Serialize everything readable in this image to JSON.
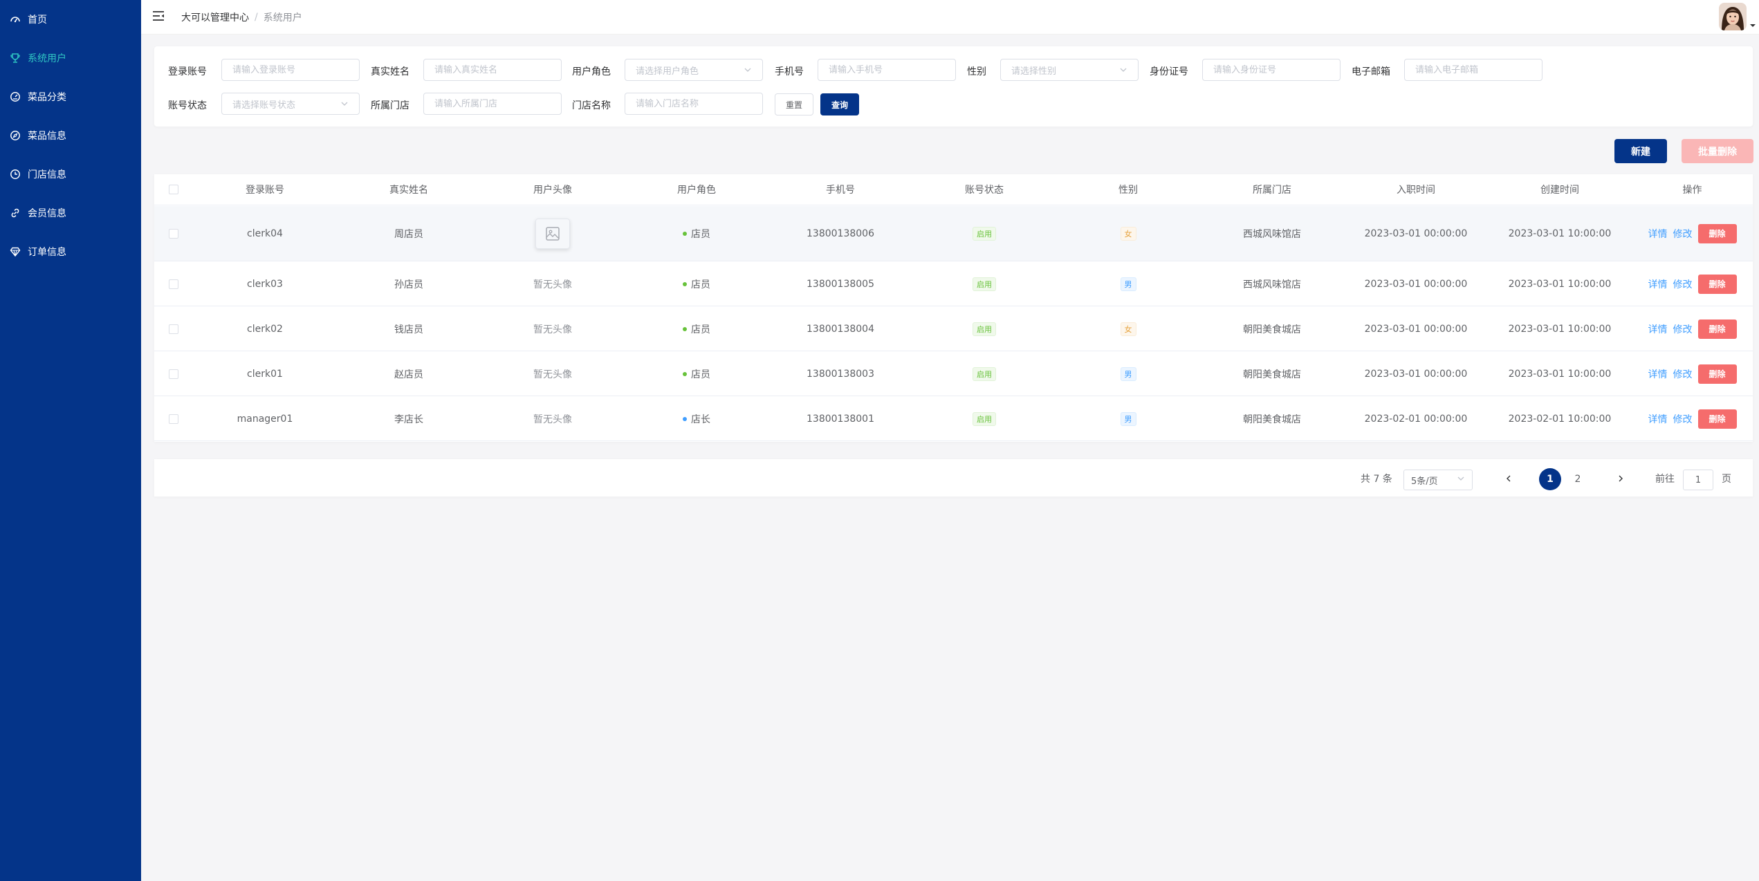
{
  "sidebar": {
    "items": [
      {
        "label": "首页",
        "icon": "dashboard-icon"
      },
      {
        "label": "系统用户",
        "icon": "trophy-icon",
        "active": true
      },
      {
        "label": "菜品分类",
        "icon": "gauge-icon"
      },
      {
        "label": "菜品信息",
        "icon": "compass-icon"
      },
      {
        "label": "门店信息",
        "icon": "clock-icon"
      },
      {
        "label": "会员信息",
        "icon": "link-icon"
      },
      {
        "label": "订单信息",
        "icon": "diamond-icon"
      }
    ],
    "bg_color": "#043489",
    "active_color": "#2fc7c3"
  },
  "header": {
    "breadcrumb_home": "大可以管理中心",
    "breadcrumb_separator": "/",
    "breadcrumb_current": "系统用户"
  },
  "filters": {
    "login_account": {
      "label": "登录账号",
      "placeholder": "请输入登录账号"
    },
    "real_name": {
      "label": "真实姓名",
      "placeholder": "请输入真实姓名"
    },
    "user_role": {
      "label": "用户角色",
      "placeholder": "请选择用户角色"
    },
    "phone": {
      "label": "手机号",
      "placeholder": "请输入手机号"
    },
    "gender": {
      "label": "性别",
      "placeholder": "请选择性别"
    },
    "id_card": {
      "label": "身份证号",
      "placeholder": "请输入身份证号"
    },
    "email": {
      "label": "电子邮箱",
      "placeholder": "请输入电子邮箱"
    },
    "account_status": {
      "label": "账号状态",
      "placeholder": "请选择账号状态"
    },
    "store": {
      "label": "所属门店",
      "placeholder": "请输入所属门店"
    },
    "store_name": {
      "label": "门店名称",
      "placeholder": "请输入门店名称"
    },
    "reset_label": "重置",
    "query_label": "查询"
  },
  "actions": {
    "new_label": "新建",
    "batch_delete_label": "批量删除"
  },
  "table": {
    "columns": [
      "登录账号",
      "真实姓名",
      "用户头像",
      "用户角色",
      "手机号",
      "账号状态",
      "性别",
      "所属门店",
      "入职时间",
      "创建时间",
      "操作"
    ],
    "rows": [
      {
        "account": "clerk04",
        "name": "周店员",
        "avatar": "",
        "role": "店员",
        "role_color": "#67c23a",
        "phone": "13800138006",
        "status": "启用",
        "gender": "女",
        "store": "西城风味馆店",
        "hire_time": "2023-03-01 00:00:00",
        "create_time": "2023-03-01 10:00:00"
      },
      {
        "account": "clerk03",
        "name": "孙店员",
        "avatar": "暂无头像",
        "role": "店员",
        "role_color": "#67c23a",
        "phone": "13800138005",
        "status": "启用",
        "gender": "男",
        "store": "西城风味馆店",
        "hire_time": "2023-03-01 00:00:00",
        "create_time": "2023-03-01 10:00:00"
      },
      {
        "account": "clerk02",
        "name": "钱店员",
        "avatar": "暂无头像",
        "role": "店员",
        "role_color": "#67c23a",
        "phone": "13800138004",
        "status": "启用",
        "gender": "女",
        "store": "朝阳美食城店",
        "hire_time": "2023-03-01 00:00:00",
        "create_time": "2023-03-01 10:00:00"
      },
      {
        "account": "clerk01",
        "name": "赵店员",
        "avatar": "暂无头像",
        "role": "店员",
        "role_color": "#67c23a",
        "phone": "13800138003",
        "status": "启用",
        "gender": "男",
        "store": "朝阳美食城店",
        "hire_time": "2023-03-01 00:00:00",
        "create_time": "2023-03-01 10:00:00"
      },
      {
        "account": "manager01",
        "name": "李店长",
        "avatar": "暂无头像",
        "role": "店长",
        "role_color": "#409eff",
        "phone": "13800138001",
        "status": "启用",
        "gender": "男",
        "store": "朝阳美食城店",
        "hire_time": "2023-02-01 00:00:00",
        "create_time": "2023-02-01 10:00:00"
      }
    ],
    "detail_label": "详情",
    "edit_label": "修改",
    "delete_label": "删除"
  },
  "pagination": {
    "total": "共 7 条",
    "page_size": "5条/页",
    "pages": [
      "1",
      "2"
    ],
    "current_page": "1",
    "goto_label": "前往",
    "goto_value": "1",
    "page_suffix": "页"
  }
}
